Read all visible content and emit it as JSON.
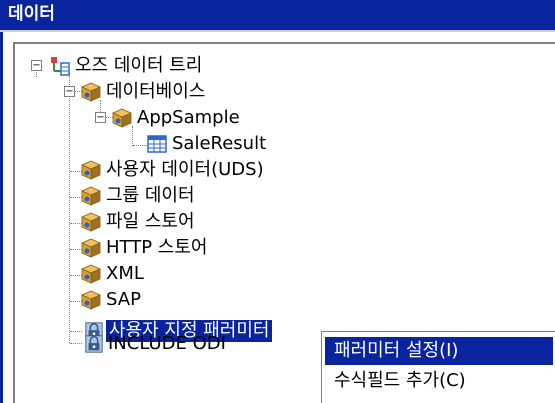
{
  "window": {
    "title": "데이터"
  },
  "tree": {
    "root": {
      "label": "오즈 데이터 트리",
      "expander": "−"
    },
    "database": {
      "label": "데이터베이스",
      "expander": "−"
    },
    "appsample": {
      "label": "AppSample",
      "expander": "−"
    },
    "saleresult": {
      "label": "SaleResult"
    },
    "uds": {
      "label": "사용자 데이터(UDS)"
    },
    "group": {
      "label": "그룹 데이터"
    },
    "filestore": {
      "label": "파일 스토어"
    },
    "httpstore": {
      "label": "HTTP 스토어"
    },
    "xml": {
      "label": "XML"
    },
    "sap": {
      "label": "SAP"
    },
    "userparams": {
      "label": "사용자 지정 패러미터",
      "selected": true
    },
    "includeodi": {
      "label": "INCLUDE ODI"
    }
  },
  "context_menu": {
    "items": [
      {
        "label": "패러미터 설정(I)",
        "highlighted": true
      },
      {
        "label": "수식필드 추가(C)",
        "highlighted": false
      }
    ]
  },
  "colors": {
    "selection": "#0a24a0",
    "title_bar": "#0a24a0",
    "db_icon": "#d8a030",
    "table_icon": "#3a8c3a"
  }
}
